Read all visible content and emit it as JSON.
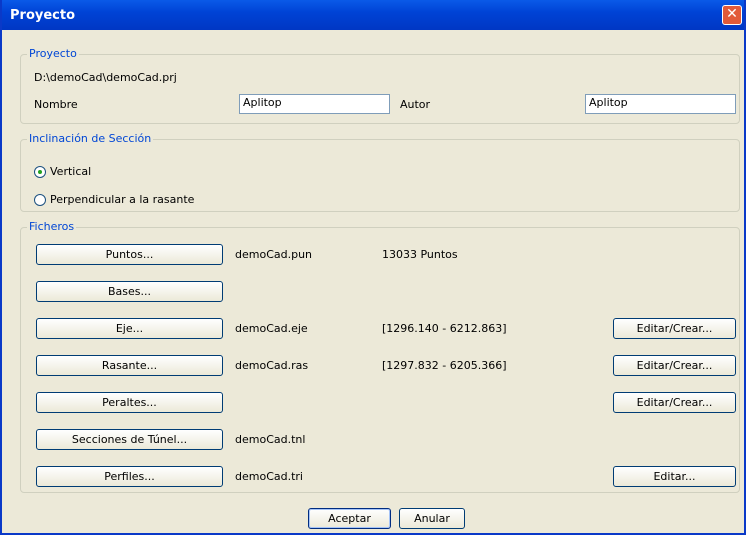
{
  "window": {
    "title": "Proyecto",
    "close": "✕"
  },
  "project": {
    "legend": "Proyecto",
    "path": "D:\\demoCad\\demoCad.prj",
    "name_label": "Nombre",
    "name_value": "Aplitop",
    "author_label": "Autor",
    "author_value": "Aplitop"
  },
  "section": {
    "legend": "Inclinación de Sección",
    "vertical": "Vertical",
    "perpendicular": "Perpendicular a la rasante",
    "selected": "Vertical"
  },
  "files": {
    "legend": "Ficheros",
    "rows": [
      {
        "button": "Puntos...",
        "file": "demoCad.pun",
        "info": "13033 Puntos",
        "action": ""
      },
      {
        "button": "Bases...",
        "file": "",
        "info": "",
        "action": ""
      },
      {
        "button": "Eje...",
        "file": "demoCad.eje",
        "info": "[1296.140 - 6212.863]",
        "action": "Editar/Crear..."
      },
      {
        "button": "Rasante...",
        "file": "demoCad.ras",
        "info": "[1297.832 - 6205.366]",
        "action": "Editar/Crear..."
      },
      {
        "button": "Peraltes...",
        "file": "",
        "info": "",
        "action": "Editar/Crear..."
      },
      {
        "button": "Secciones de Túnel...",
        "file": "demoCad.tnl",
        "info": "",
        "action": ""
      },
      {
        "button": "Perfiles...",
        "file": "demoCad.tri",
        "info": "",
        "action": "Editar..."
      }
    ]
  },
  "footer": {
    "accept": "Aceptar",
    "cancel": "Anular"
  }
}
